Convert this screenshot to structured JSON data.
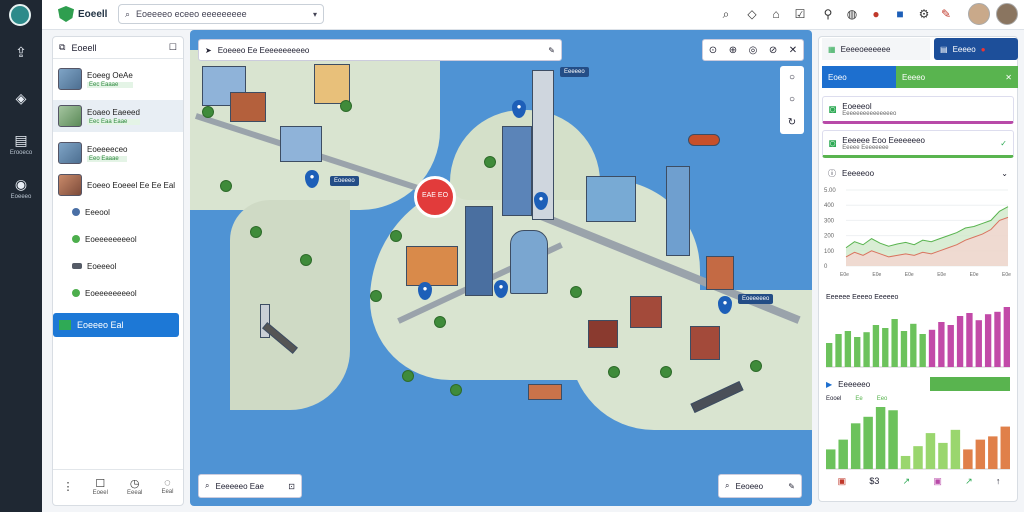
{
  "rail": {
    "items": [
      {
        "icon": "upload-icon",
        "glyph": "⇪",
        "label": ""
      },
      {
        "icon": "tag-icon",
        "glyph": "⌂",
        "label": ""
      },
      {
        "icon": "panel-icon",
        "glyph": "▤",
        "label": "Erooeco"
      },
      {
        "icon": "compass-icon",
        "glyph": "◉",
        "label": "Eoeeeo"
      }
    ]
  },
  "topbar": {
    "brand": "Eoeell",
    "search_placeholder": "Eoeeeeo eceeo eeeeeeeee"
  },
  "left_panel": {
    "title": "Eoeell",
    "items": [
      {
        "title": "Eoeeg OeAe",
        "badge": "Eec Eaaae"
      },
      {
        "title": "Eoaeo Eaeeed",
        "badge": "Eec Eaa Eaae"
      },
      {
        "title": "Eoeeeeceo",
        "badge": "Eeo Eaaae"
      },
      {
        "title": "Eoeeo Eoeeel Ee Ee Eal",
        "badge": ""
      }
    ],
    "layers": [
      {
        "label": "Eeeool",
        "color": "#4a6fa5"
      },
      {
        "label": "Eoeeeeeeeeol",
        "color": "#4cae4c"
      },
      {
        "label": "Eoeeeol",
        "color": "#555b66"
      },
      {
        "label": "Eoeeeeeeeeol",
        "color": "#4cae4c"
      }
    ],
    "active_label": "Eoeeeo Eal",
    "footer": [
      "Eoeel",
      "Eeeal",
      "Eeal"
    ]
  },
  "map": {
    "title": "Eoeeeo Ee Eeeeeeeeeeo",
    "main_pin_label": "EAE EO",
    "labels": [
      {
        "text": "Eeeeeo"
      },
      {
        "text": "Eoeeeo"
      },
      {
        "text": "Eoeeeeeo"
      }
    ],
    "search_label": "Eeeeeeo Eae",
    "find_label": "Eeoeeo"
  },
  "right_panel": {
    "tab1": "Eeeeoeeeeee",
    "tab2": "Eeeeo",
    "tab3": "Eoeo",
    "tab4": "Eeeeo",
    "card1_title": "Eoeeeol",
    "card1_sub": "Eeeeeeeeeeeeeeeo",
    "card2_title": "Eeeeee Eoo Eeeeeeeo",
    "card2_sub": "Eeeee Eeeeeeee",
    "chart1_title": "Eeeeeoo",
    "chart1_yticks": [
      "5.00",
      "400",
      "300",
      "200",
      "100",
      "0"
    ],
    "chart1_xticks": [
      "E0e",
      "E0e",
      "E0e",
      "E0e",
      "E0e",
      "E0e"
    ],
    "chart2_title": "Eeeeee Eeeeo Eeeeeo",
    "chart3_title": "Eeeeeeo",
    "chart3_legend": [
      "Eooel",
      "Ee",
      "Eeo"
    ]
  },
  "chart_data": [
    {
      "type": "area",
      "title": "Eeeeeoo",
      "series": [
        {
          "values": [
            120,
            160,
            140,
            180,
            150,
            130,
            145,
            155,
            140,
            170,
            160,
            180,
            200,
            220,
            250,
            260,
            280,
            300,
            360,
            390
          ]
        },
        {
          "values": [
            60,
            90,
            70,
            100,
            80,
            60,
            70,
            80,
            70,
            90,
            80,
            100,
            120,
            140,
            170,
            190,
            210,
            240,
            300,
            320
          ]
        }
      ],
      "ylim": [
        0,
        500
      ]
    },
    {
      "type": "bar",
      "title": "Eeeeee Eeeeo Eeeeeo",
      "values": [
        40,
        55,
        60,
        50,
        58,
        70,
        65,
        80,
        60,
        72,
        55,
        62,
        75,
        70,
        85,
        90,
        78,
        88,
        92,
        100
      ]
    },
    {
      "type": "bar",
      "title": "Eeeeeeo",
      "values": [
        30,
        45,
        70,
        80,
        95,
        90,
        20,
        35,
        55,
        40,
        60,
        30,
        45,
        50,
        65
      ]
    }
  ]
}
